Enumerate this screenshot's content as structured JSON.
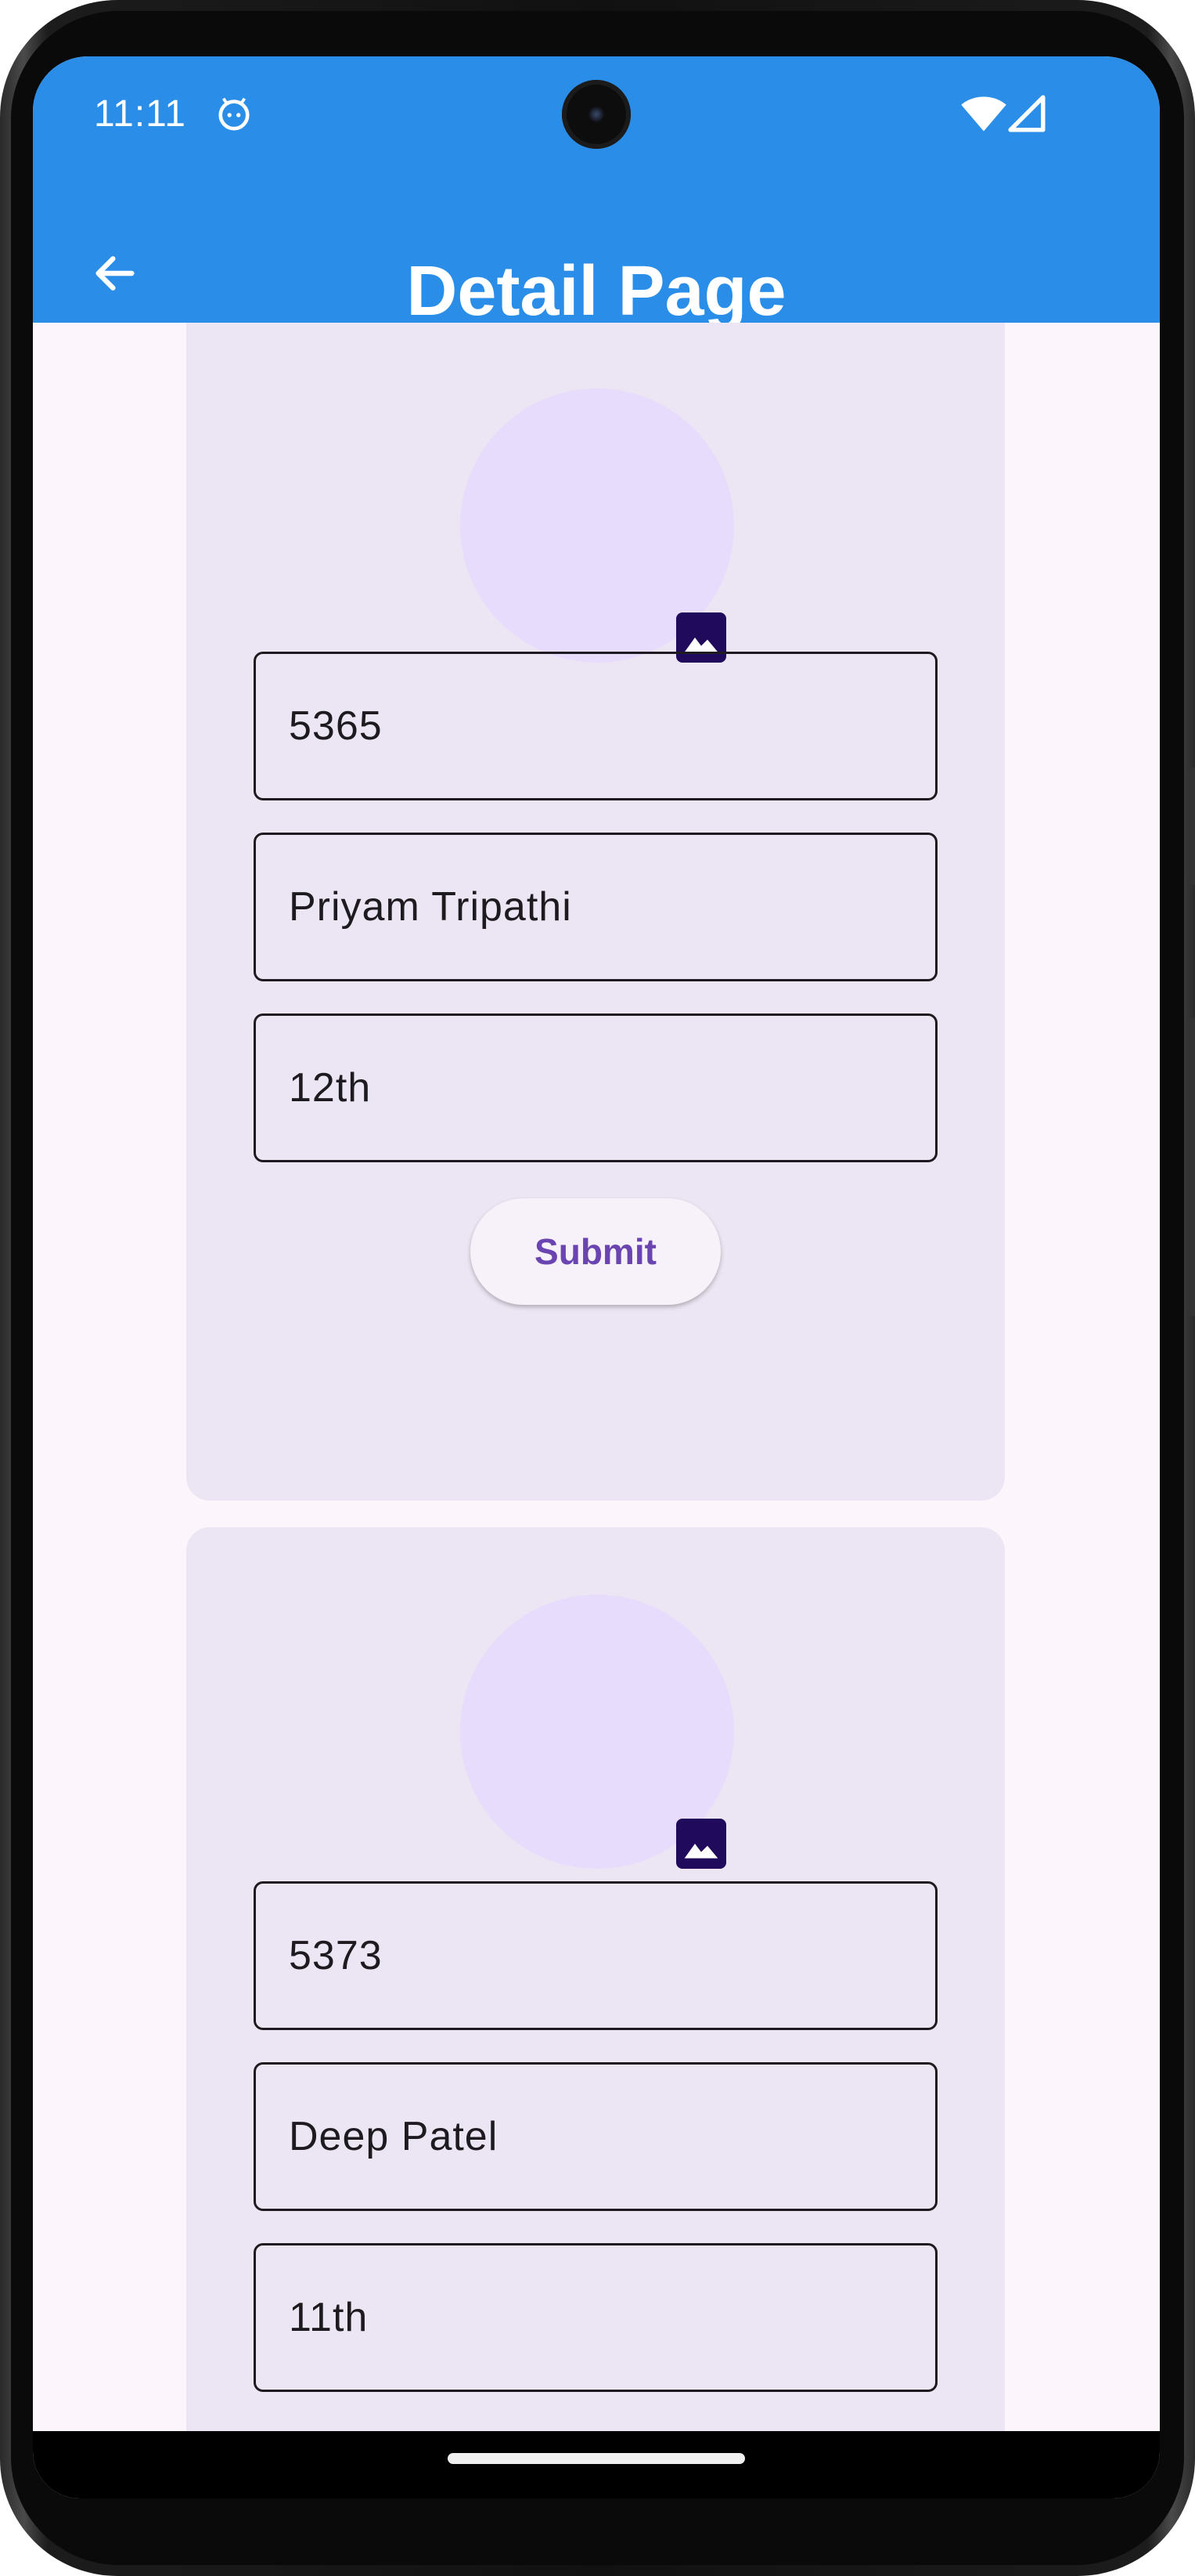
{
  "status_bar": {
    "time": "11:11",
    "icons": [
      "android-robot-icon",
      "wifi-icon",
      "cell-signal-icon"
    ]
  },
  "app_bar": {
    "title": "Detail Page",
    "back_icon": "arrow-left-icon",
    "color": "#2a8ee8"
  },
  "cards": [
    {
      "avatar_icon": "image-icon",
      "fields": [
        "5365",
        "Priyam Tripathi",
        "12th"
      ],
      "submit_label": "Submit"
    },
    {
      "avatar_icon": "image-icon",
      "fields": [
        "5373",
        "Deep Patel",
        "11th"
      ]
    }
  ],
  "colors": {
    "background": "#fcf6fc",
    "card": "#ece6f4",
    "avatar": "#e8dcfc",
    "image_button": "#1f0a5c",
    "submit_text": "#6a44b0"
  }
}
